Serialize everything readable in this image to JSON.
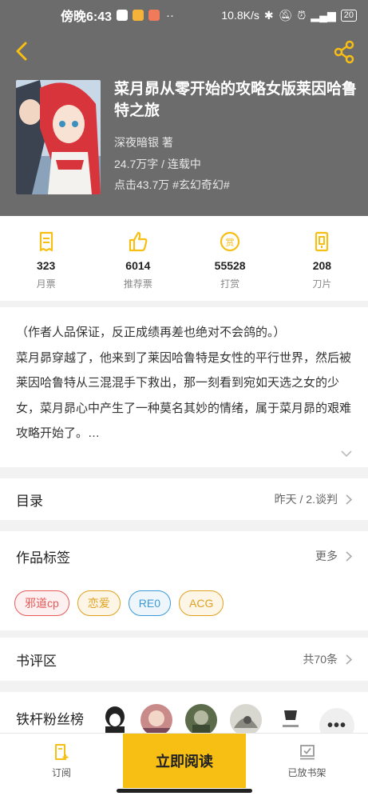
{
  "status_bar": {
    "time": "傍晚6:43",
    "network_speed": "10.8K/s",
    "battery": "20"
  },
  "book": {
    "title": "菜月昴从零开始的攻略女版莱因哈鲁特之旅",
    "author": "深夜暗银 著",
    "word_status": "24.7万字 / 连载中",
    "clicks_genre": "点击43.7万 #玄幻奇幻#"
  },
  "stats": [
    {
      "icon": "monthly-ticket-icon",
      "value": "323",
      "label": "月票"
    },
    {
      "icon": "thumbs-up-icon",
      "value": "6014",
      "label": "推荐票"
    },
    {
      "icon": "reward-icon",
      "value": "55528",
      "label": "打赏"
    },
    {
      "icon": "blade-icon",
      "value": "208",
      "label": "刀片"
    }
  ],
  "synopsis": {
    "line1": "（作者人品保证，反正成绩再差也绝对不会鸽的。）",
    "line2": "菜月昴穿越了，他来到了莱因哈鲁特是女性的平行世界，然后被莱因哈鲁特从三混混手下救出，那一刻看到宛如天选之女的少女，菜月昴心中产生了一种莫名其妙的情绪，属于菜月昴的艰难攻略开始了。…"
  },
  "toc": {
    "label": "目录",
    "latest": "昨天 / 2.谈判"
  },
  "tags_section": {
    "label": "作品标签",
    "more": "更多"
  },
  "tags": [
    {
      "text": "邪道cp",
      "color": "#e85a5a",
      "bg": "#fdf0f0"
    },
    {
      "text": "恋爱",
      "color": "#e0a020",
      "bg": "#fdf6e6"
    },
    {
      "text": "RE0",
      "color": "#3a9ad9",
      "bg": "#eef6fc"
    },
    {
      "text": "ACG",
      "color": "#e0a020",
      "bg": "#fdf6e6"
    }
  ],
  "reviews": {
    "label": "书评区",
    "count": "共70条"
  },
  "fans": {
    "label": "铁杆粉丝榜",
    "more": "•••"
  },
  "bottom_bar": {
    "subscribe": "订阅",
    "read_now": "立即阅读",
    "on_shelf": "已放书架"
  },
  "colors": {
    "accent": "#f7be13",
    "header_bg": "#6c6c6c"
  }
}
